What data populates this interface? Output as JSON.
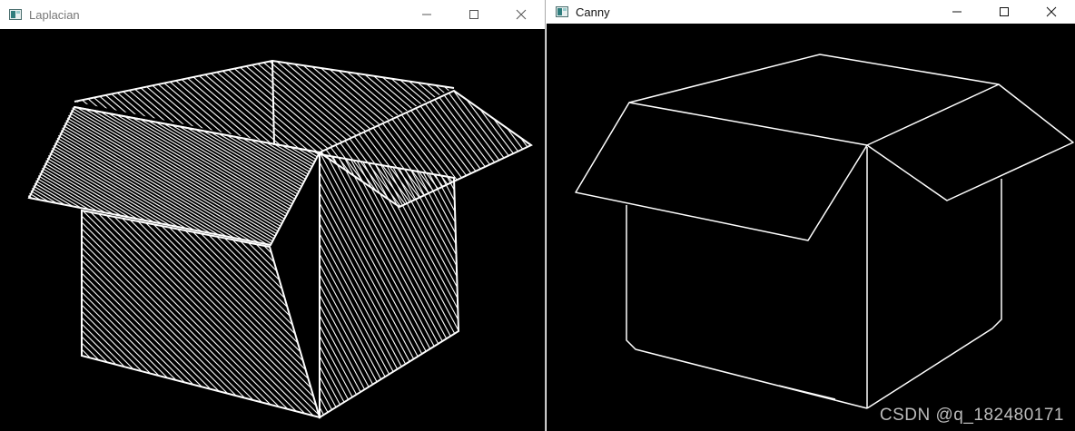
{
  "windows": [
    {
      "title": "Laplacian",
      "icon": "app-window-icon",
      "controls": [
        "minimize-icon",
        "maximize-icon",
        "close-icon"
      ]
    },
    {
      "title": "Canny",
      "icon": "app-window-icon",
      "controls": [
        "minimize-icon",
        "maximize-icon",
        "close-icon"
      ]
    }
  ],
  "watermark": "CSDN @q_182480171",
  "colors": {
    "image_background": "#000000",
    "edges": "#ffffff",
    "titlebar": "#ffffff"
  }
}
